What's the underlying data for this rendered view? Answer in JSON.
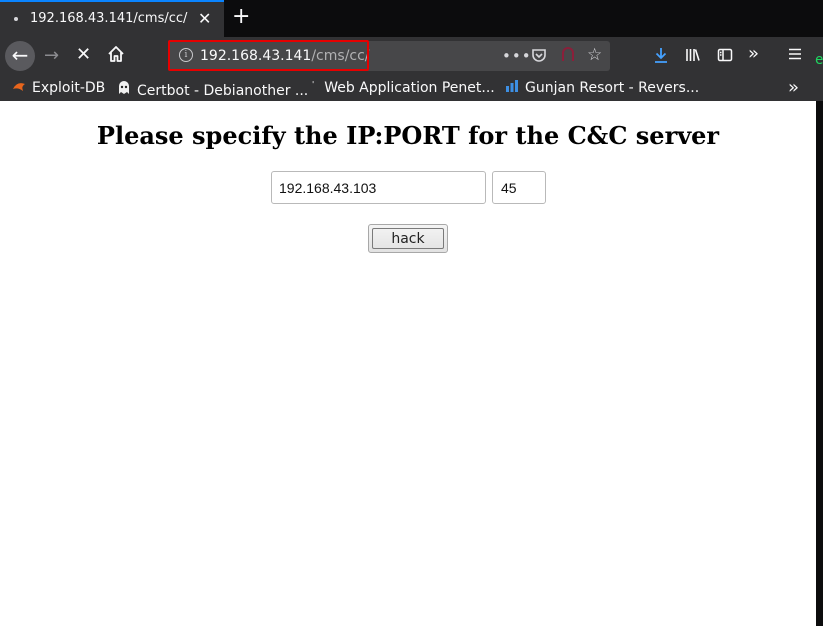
{
  "browser": {
    "tab_title": "192.168.43.141/cms/cc/",
    "tab_close": "✕",
    "new_tab": "+",
    "url_host": "192.168.43.141",
    "url_path": "/cms/cc/",
    "bookmarks": [
      {
        "label": "Exploit-DB",
        "icon": "exploit-db-icon"
      },
      {
        "label": "Certbot - Debianother ...",
        "icon": "certbot-icon"
      },
      {
        "label": "Web Application Penet...",
        "icon": "generic-page-icon"
      },
      {
        "label": "Gunjan Resort - Revers...",
        "icon": "chart-icon"
      }
    ],
    "overflow": "»",
    "accent_color": "#0a84ff",
    "highlight_color": "#e60000"
  },
  "page": {
    "heading": "Please specify the IP:PORT for the C&C server",
    "ip_value": "192.168.43.103",
    "port_value": "45",
    "button_label": "hack"
  }
}
